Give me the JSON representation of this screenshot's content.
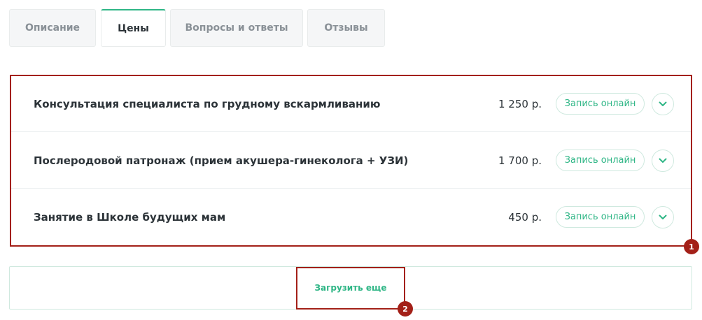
{
  "tabs": [
    {
      "label": "Описание",
      "active": false
    },
    {
      "label": "Цены",
      "active": true
    },
    {
      "label": "Вопросы и ответы",
      "active": false
    },
    {
      "label": "Отзывы",
      "active": false
    }
  ],
  "price_list": {
    "items": [
      {
        "name": "Консультация специалиста по грудному вскармливанию",
        "price": "1 250 р.",
        "book_label": "Запись онлайн",
        "expand_icon": "chevron-down-icon"
      },
      {
        "name": "Послеродовой патронаж (прием акушера-гинеколога + УЗИ)",
        "price": "1 700 р.",
        "book_label": "Запись онлайн",
        "expand_icon": "chevron-down-icon"
      },
      {
        "name": "Занятие в Школе будущих мам",
        "price": "450 р.",
        "book_label": "Запись онлайн",
        "expand_icon": "chevron-down-icon"
      }
    ]
  },
  "load_more": {
    "label": "Загрузить еще"
  },
  "annotations": [
    {
      "number": "1"
    },
    {
      "number": "2"
    }
  ],
  "colors": {
    "accent": "#2fb686",
    "annotation": "#a32018",
    "text_dark": "#2c3338",
    "tab_inactive_text": "#8a9197"
  }
}
